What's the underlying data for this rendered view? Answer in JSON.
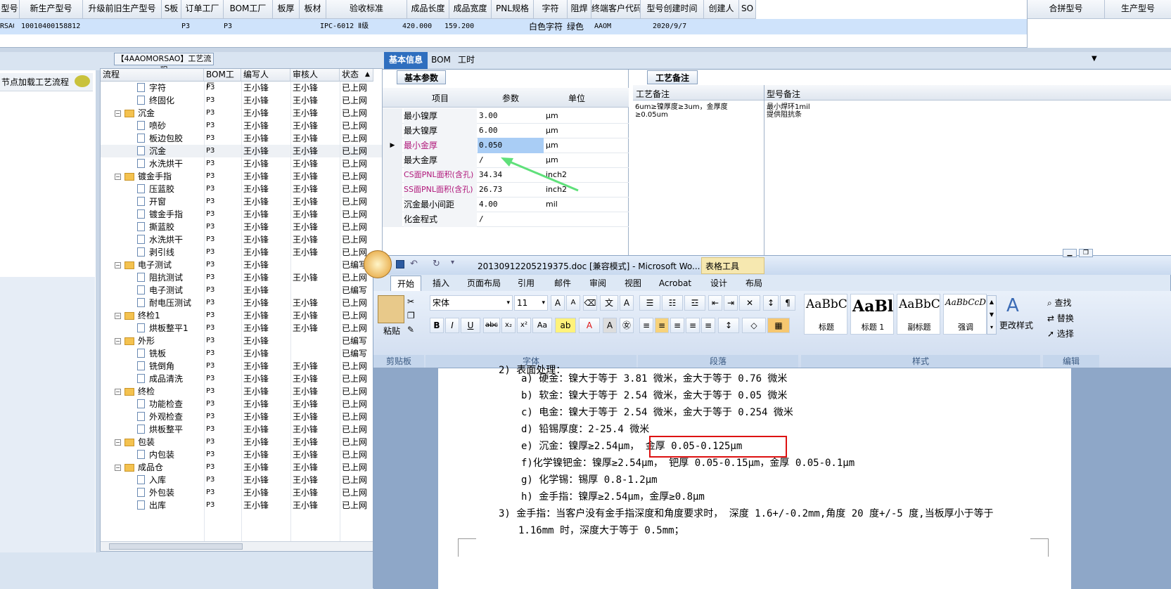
{
  "top_grid": {
    "headers": [
      "型号",
      "新生产型号",
      "升级前旧生产型号",
      "S板",
      "订单工厂",
      "BOM工厂",
      "板厚",
      "板材",
      "验收标准",
      "成品长度",
      "成品宽度",
      "PNL规格",
      "字符",
      "阻焊",
      "终端客户代码",
      "型号创建时间",
      "创建人",
      "SO"
    ],
    "row": {
      "model": "RSAO",
      "new_model": "10010400158812",
      "s_board": "P3",
      "order_factory": "P3",
      "standard": "IPC-6012 Ⅱ级",
      "length": "420.000",
      "width": "159.200",
      "char": "白色字符",
      "solder": "绿色",
      "customer": "AAOM",
      "created": "2020/9/7"
    }
  },
  "right_grid": {
    "headers": [
      "合拼型号",
      "生产型号"
    ]
  },
  "left_panel": {
    "title": "【4AAOMORSAO】工艺流程",
    "load_label": "节点加载工艺流程"
  },
  "tree": {
    "headers": [
      "流程",
      "BOM工厂",
      "编写人",
      "审核人",
      "状态"
    ],
    "rows": [
      {
        "label": "字符",
        "type": "doc",
        "level": 2,
        "bom": "P3",
        "writer": "王小锋",
        "reviewer": "王小锋",
        "status": "已上网"
      },
      {
        "label": "终固化",
        "type": "doc",
        "level": 2,
        "bom": "P3",
        "writer": "王小锋",
        "reviewer": "王小锋",
        "status": "已上网"
      },
      {
        "label": "沉金",
        "type": "folder",
        "level": 1,
        "bom": "P3",
        "writer": "王小锋",
        "reviewer": "王小锋",
        "status": "已上网"
      },
      {
        "label": "喷砂",
        "type": "doc",
        "level": 2,
        "bom": "P3",
        "writer": "王小锋",
        "reviewer": "王小锋",
        "status": "已上网"
      },
      {
        "label": "板边包胶",
        "type": "doc",
        "level": 2,
        "bom": "P3",
        "writer": "王小锋",
        "reviewer": "王小锋",
        "status": "已上网"
      },
      {
        "label": "沉金",
        "type": "doc",
        "level": 2,
        "bom": "P3",
        "writer": "王小锋",
        "reviewer": "王小锋",
        "status": "已上网"
      },
      {
        "label": "水洗烘干",
        "type": "doc",
        "level": 2,
        "bom": "P3",
        "writer": "王小锋",
        "reviewer": "王小锋",
        "status": "已上网"
      },
      {
        "label": "镀金手指",
        "type": "folder",
        "level": 1,
        "bom": "P3",
        "writer": "王小锋",
        "reviewer": "王小锋",
        "status": "已上网"
      },
      {
        "label": "压蓝胶",
        "type": "doc",
        "level": 2,
        "bom": "P3",
        "writer": "王小锋",
        "reviewer": "王小锋",
        "status": "已上网"
      },
      {
        "label": "开窗",
        "type": "doc",
        "level": 2,
        "bom": "P3",
        "writer": "王小锋",
        "reviewer": "王小锋",
        "status": "已上网"
      },
      {
        "label": "镀金手指",
        "type": "doc",
        "level": 2,
        "bom": "P3",
        "writer": "王小锋",
        "reviewer": "王小锋",
        "status": "已上网"
      },
      {
        "label": "撕蓝胶",
        "type": "doc",
        "level": 2,
        "bom": "P3",
        "writer": "王小锋",
        "reviewer": "王小锋",
        "status": "已上网"
      },
      {
        "label": "水洗烘干",
        "type": "doc",
        "level": 2,
        "bom": "P3",
        "writer": "王小锋",
        "reviewer": "王小锋",
        "status": "已上网"
      },
      {
        "label": "剥引线",
        "type": "doc",
        "level": 2,
        "bom": "P3",
        "writer": "王小锋",
        "reviewer": "王小锋",
        "status": "已上网"
      },
      {
        "label": "电子测试",
        "type": "folder",
        "level": 1,
        "bom": "P3",
        "writer": "王小锋",
        "reviewer": "",
        "status": "已编写"
      },
      {
        "label": "阻抗测试",
        "type": "doc",
        "level": 2,
        "bom": "P3",
        "writer": "王小锋",
        "reviewer": "王小锋",
        "status": "已上网"
      },
      {
        "label": "电子测试",
        "type": "doc",
        "level": 2,
        "bom": "P3",
        "writer": "王小锋",
        "reviewer": "",
        "status": "已编写"
      },
      {
        "label": "耐电压测试",
        "type": "doc",
        "level": 2,
        "bom": "P3",
        "writer": "王小锋",
        "reviewer": "王小锋",
        "status": "已上网"
      },
      {
        "label": "终检1",
        "type": "folder",
        "level": 1,
        "bom": "P3",
        "writer": "王小锋",
        "reviewer": "王小锋",
        "status": "已上网"
      },
      {
        "label": "烘板整平1",
        "type": "doc",
        "level": 2,
        "bom": "P3",
        "writer": "王小锋",
        "reviewer": "王小锋",
        "status": "已上网"
      },
      {
        "label": "外形",
        "type": "folder",
        "level": 1,
        "bom": "P3",
        "writer": "王小锋",
        "reviewer": "",
        "status": "已编写"
      },
      {
        "label": "铣板",
        "type": "doc",
        "level": 2,
        "bom": "P3",
        "writer": "王小锋",
        "reviewer": "",
        "status": "已编写"
      },
      {
        "label": "铣倒角",
        "type": "doc",
        "level": 2,
        "bom": "P3",
        "writer": "王小锋",
        "reviewer": "王小锋",
        "status": "已上网"
      },
      {
        "label": "成品清洗",
        "type": "doc",
        "level": 2,
        "bom": "P3",
        "writer": "王小锋",
        "reviewer": "王小锋",
        "status": "已上网"
      },
      {
        "label": "终检",
        "type": "folder",
        "level": 1,
        "bom": "P3",
        "writer": "王小锋",
        "reviewer": "王小锋",
        "status": "已上网"
      },
      {
        "label": "功能检查",
        "type": "doc",
        "level": 2,
        "bom": "P3",
        "writer": "王小锋",
        "reviewer": "王小锋",
        "status": "已上网"
      },
      {
        "label": "外观检查",
        "type": "doc",
        "level": 2,
        "bom": "P3",
        "writer": "王小锋",
        "reviewer": "王小锋",
        "status": "已上网"
      },
      {
        "label": "烘板整平",
        "type": "doc",
        "level": 2,
        "bom": "P3",
        "writer": "王小锋",
        "reviewer": "王小锋",
        "status": "已上网"
      },
      {
        "label": "包装",
        "type": "folder",
        "level": 1,
        "bom": "P3",
        "writer": "王小锋",
        "reviewer": "王小锋",
        "status": "已上网"
      },
      {
        "label": "内包装",
        "type": "doc",
        "level": 2,
        "bom": "P3",
        "writer": "王小锋",
        "reviewer": "王小锋",
        "status": "已上网"
      },
      {
        "label": "成品仓",
        "type": "folder",
        "level": 1,
        "bom": "P3",
        "writer": "王小锋",
        "reviewer": "王小锋",
        "status": "已上网"
      },
      {
        "label": "入库",
        "type": "doc",
        "level": 2,
        "bom": "P3",
        "writer": "王小锋",
        "reviewer": "王小锋",
        "status": "已上网"
      },
      {
        "label": "外包装",
        "type": "doc",
        "level": 2,
        "bom": "P3",
        "writer": "王小锋",
        "reviewer": "王小锋",
        "status": "已上网"
      },
      {
        "label": "出库",
        "type": "doc",
        "level": 2,
        "bom": "P3",
        "writer": "王小锋",
        "reviewer": "王小锋",
        "status": "已上网"
      }
    ]
  },
  "mid_tabs": [
    "基本信息",
    "BOM",
    "工时"
  ],
  "params": {
    "section_title": "基本参数",
    "headers": [
      "项目",
      "参数",
      "单位"
    ],
    "rows": [
      {
        "item": "最小镍厚",
        "value": "3.00",
        "unit": "μm"
      },
      {
        "item": "最大镍厚",
        "value": "6.00",
        "unit": "μm"
      },
      {
        "item": "最小金厚",
        "value": "0.050",
        "unit": "μm",
        "selected": true
      },
      {
        "item": "最大金厚",
        "value": "/",
        "unit": "μm"
      },
      {
        "item": "CS面PNL面积(含孔)",
        "value": "34.34",
        "unit": "inch2",
        "highlight": true
      },
      {
        "item": "SS面PNL面积(含孔)",
        "value": "26.73",
        "unit": "inch2",
        "highlight": true
      },
      {
        "item": "沉金最小间距",
        "value": "4.00",
        "unit": "mil"
      },
      {
        "item": "化金程式",
        "value": "/",
        "unit": ""
      }
    ]
  },
  "remarks": {
    "section_title": "工艺备注",
    "col1": "工艺备注",
    "col2": "型号备注",
    "process_note": "6um≥镍厚度≥3um，金厚度≥0.05um",
    "model_note_line1": "最小焊环1mil",
    "model_note_line2": "提供阻抗条"
  },
  "word": {
    "title": "20130912205219375.doc [兼容模式] - Microsoft Wo...",
    "context_tab": "表格工具",
    "tabs": [
      "开始",
      "插入",
      "页面布局",
      "引用",
      "邮件",
      "审阅",
      "视图",
      "Acrobat",
      "设计",
      "布局"
    ],
    "font_name": "宋体",
    "font_size": "11",
    "paste_label": "粘贴",
    "styles": [
      {
        "preview": "AaBbC",
        "name": "标题"
      },
      {
        "preview": "AaBl",
        "name": "标题 1"
      },
      {
        "preview": "AaBbC",
        "name": "副标题"
      },
      {
        "preview": "AaBbCcDd",
        "name": "强调"
      }
    ],
    "change_style": "更改样式",
    "edit_items": [
      "查找",
      "替换",
      "选择"
    ],
    "groups": [
      "剪贴板",
      "字体",
      "段落",
      "样式",
      "编辑"
    ],
    "lines": [
      "2) 表面处理：",
      "a) 硬金：镍大于等于 3.81 微米，金大于等于 0.76 微米",
      "b) 软金：镍大于等于 2.54 微米，金大于等于 0.05 微米",
      "c) 电金：镍大于等于 2.54 微米，金大于等于 0.254 微米",
      "d) 铅锡厚度：2-25.4 微米",
      "e)  沉金：镍厚≥2.54μm， 金厚 0.05-0.125μm",
      "f)化学镍钯金：镍厚≥2.54μm， 钯厚 0.05-0.15μm，金厚 0.05-0.1μm",
      "g)  化学锡：锡厚 0.8-1.2μm",
      "h) 金手指：镍厚≥2.54μm，金厚≥0.8μm",
      "3) 金手指：当客户没有金手指深度和角度要求时， 深度 1.6+/-0.2mm,角度 20 度+/-5 度,当板厚小于等于",
      "1.16mm 时，深度大于等于 0.5mm；"
    ]
  },
  "colors": {
    "accent": "#2f6fbf",
    "highlight_red": "#d11",
    "arrow": "#5fe07a",
    "pink": "#b0177a"
  }
}
